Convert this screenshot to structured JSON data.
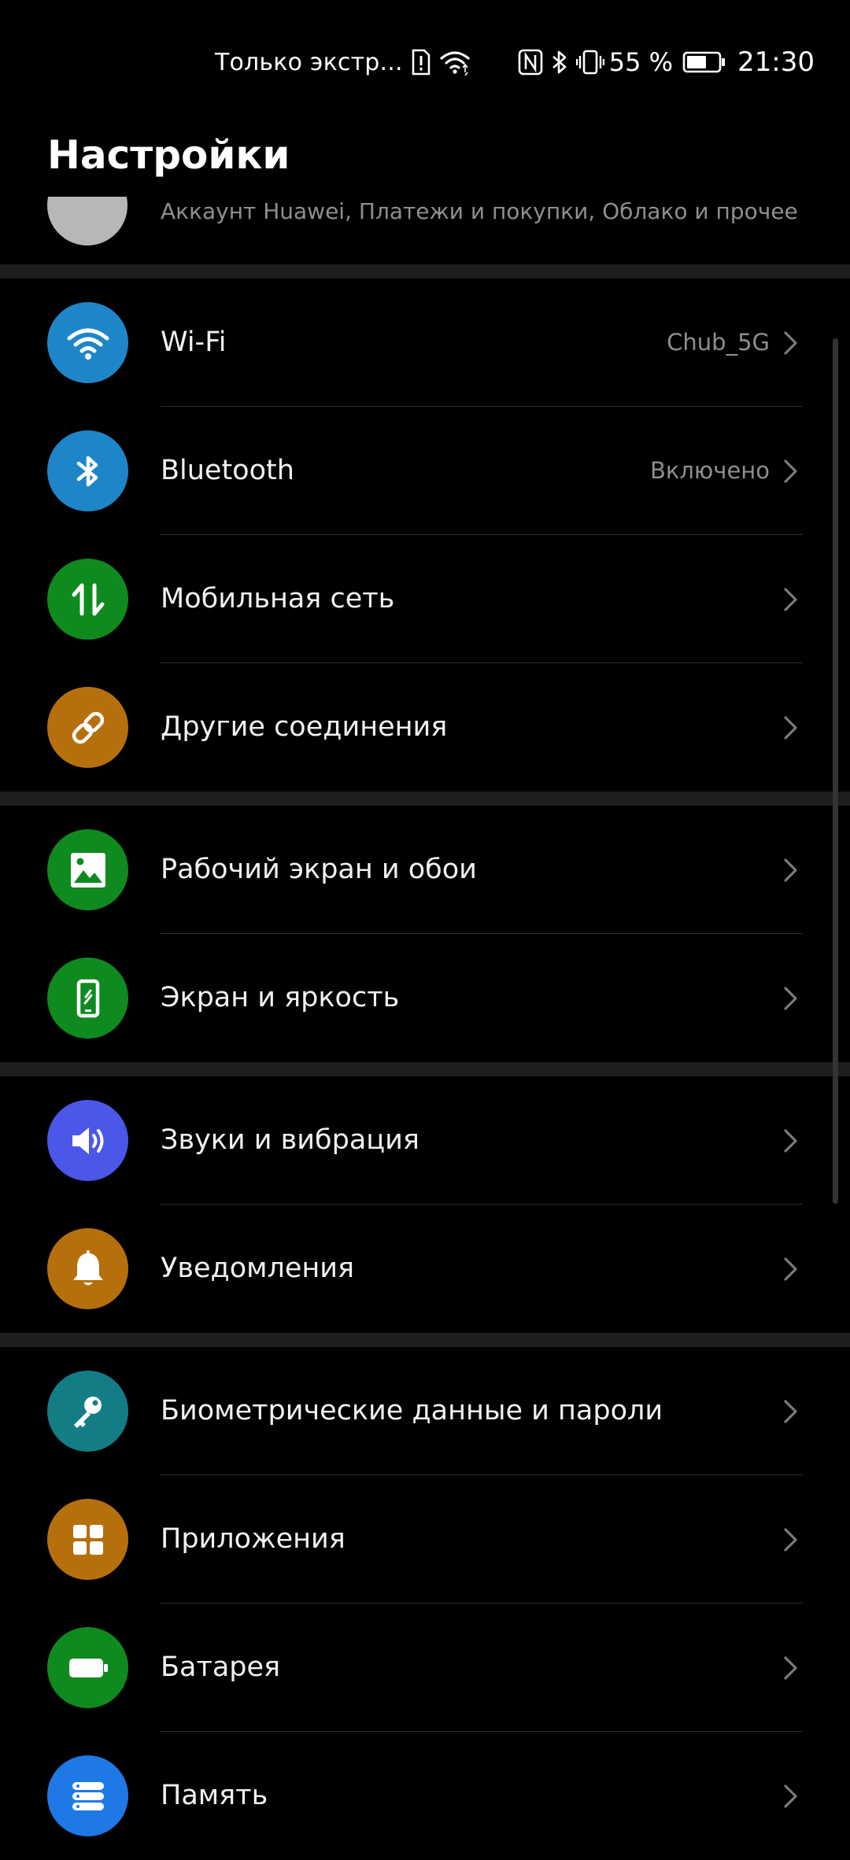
{
  "status_bar": {
    "carrier": "Только экстр...",
    "battery_percent": "55 %",
    "time": "21:30"
  },
  "page_title": "Настройки",
  "account": {
    "subtitle": "Аккаунт Huawei, Платежи и покупки, Облако и прочее"
  },
  "colors": {
    "wifi": "#1e86c8",
    "bluetooth": "#1e86c8",
    "mobile": "#0f8a1f",
    "other": "#b5700d",
    "home": "#0f8a1f",
    "display": "#0f8a1f",
    "sound": "#4a57e8",
    "notifications": "#b5700d",
    "biometrics": "#137d86",
    "apps": "#b5700d",
    "battery": "#0f8a1f",
    "storage": "#1e78e6"
  },
  "settings": [
    {
      "label": "Wi-Fi",
      "value": "Chub_5G",
      "icon": "wifi-icon"
    },
    {
      "label": "Bluetooth",
      "value": "Включено",
      "icon": "bluetooth-icon"
    },
    {
      "label": "Мобильная сеть",
      "icon": "mobile-data-icon"
    },
    {
      "label": "Другие соединения",
      "icon": "link-icon"
    },
    {
      "label": "Рабочий экран и обои",
      "icon": "wallpaper-icon"
    },
    {
      "label": "Экран и яркость",
      "icon": "display-icon"
    },
    {
      "label": "Звуки и вибрация",
      "icon": "speaker-icon"
    },
    {
      "label": "Уведомления",
      "icon": "bell-icon"
    },
    {
      "label": "Биометрические данные и пароли",
      "icon": "key-icon"
    },
    {
      "label": "Приложения",
      "icon": "apps-grid-icon"
    },
    {
      "label": "Батарея",
      "icon": "battery-icon"
    },
    {
      "label": "Память",
      "icon": "storage-icon"
    }
  ]
}
